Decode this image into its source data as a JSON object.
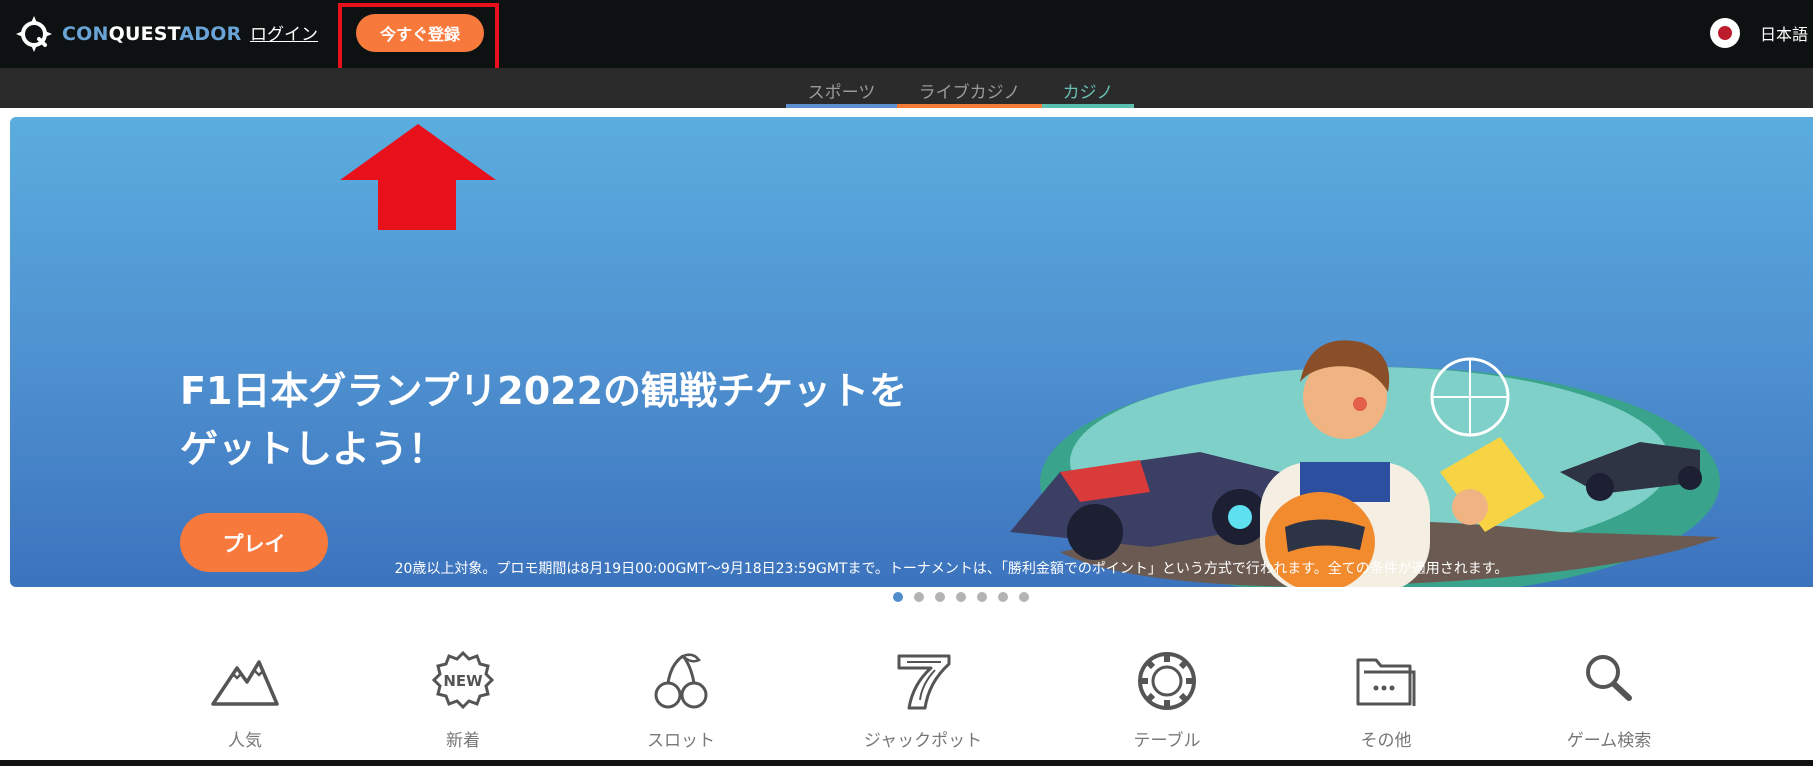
{
  "header": {
    "logo": {
      "part1": "CON",
      "part2": "QUEST",
      "part3": "ADOR"
    },
    "login_label": "ログイン",
    "register_label": "今すぐ登録",
    "language_label": "日本語"
  },
  "subnav": {
    "tabs": [
      {
        "label": "スポーツ",
        "color": "#5b8fcf"
      },
      {
        "label": "ライブカジノ",
        "color": "#f47a3a"
      },
      {
        "label": "カジノ",
        "color": "#59bfae"
      }
    ]
  },
  "banner": {
    "title": "F1日本グランプリ2022の観戦チケットをゲットしよう！",
    "play_label": "プレイ",
    "disclaimer": "20歳以上対象。プロモ期間は8月19日00:00GMT～9月18日23:59GMTまで。トーナメントは、「勝利金額でのポイント」という方式で行われます。全ての条件が適用されます。",
    "slide_count": 7,
    "active_slide": 1
  },
  "categories": [
    {
      "label": "人気",
      "icon": "mountain-icon"
    },
    {
      "label": "新着",
      "icon": "new-badge-icon"
    },
    {
      "label": "スロット",
      "icon": "cherry-icon"
    },
    {
      "label": "ジャックポット",
      "icon": "seven-icon"
    },
    {
      "label": "テーブル",
      "icon": "chip-icon"
    },
    {
      "label": "その他",
      "icon": "folder-icon"
    },
    {
      "label": "ゲーム検索",
      "icon": "search-icon"
    }
  ],
  "colors": {
    "header_bg": "#0d1112",
    "accent_orange": "#f77a3c",
    "annotation_red": "#e8101b",
    "banner_top": "#5badde",
    "banner_bottom": "#3c73bd"
  }
}
